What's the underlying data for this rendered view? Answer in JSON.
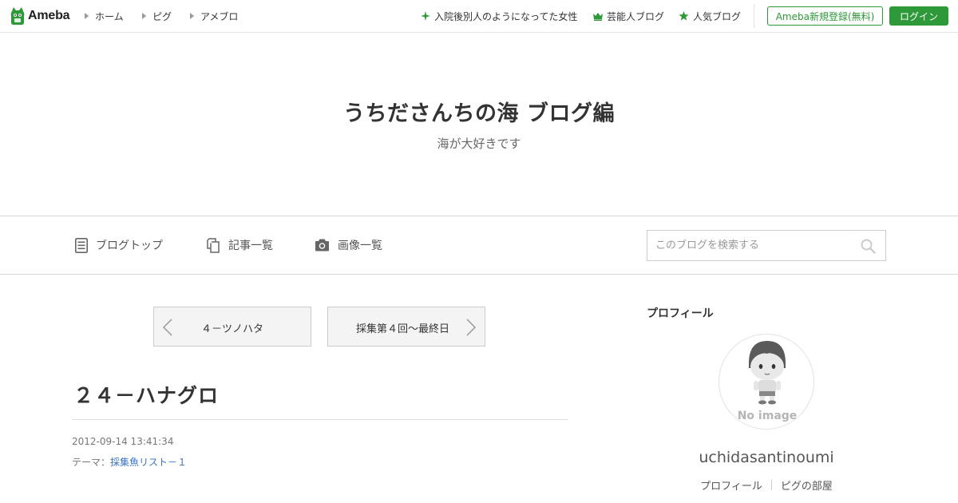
{
  "header": {
    "logo_text": "Ameba",
    "nav": [
      {
        "label": "ホーム"
      },
      {
        "label": "ピグ"
      },
      {
        "label": "アメブロ"
      }
    ],
    "right_links": [
      {
        "label": "入院後別人のようになってた女性",
        "icon": "sparkle-icon"
      },
      {
        "label": "芸能人ブログ",
        "icon": "crown-icon"
      },
      {
        "label": "人気ブログ",
        "icon": "star-icon"
      }
    ],
    "register_label": "Ameba新規登録(無料)",
    "login_label": "ログイン",
    "accent_color": "#2e9939"
  },
  "blog": {
    "title": "うちださんちの海 ブログ編",
    "subtitle": "海が大好きです"
  },
  "blog_nav": {
    "items": [
      {
        "label": "ブログトップ",
        "icon": "document-icon"
      },
      {
        "label": "記事一覧",
        "icon": "copy-icon"
      },
      {
        "label": "画像一覧",
        "icon": "camera-icon"
      }
    ],
    "search_placeholder": "このブログを検索する"
  },
  "pager": {
    "prev_label": "４－ツノハタ",
    "next_label": "採集第４回～最終日"
  },
  "entry": {
    "title": "２４－ハナグロ",
    "date": "2012-09-14 13:41:34",
    "theme_prefix": "テーマ：",
    "theme_label": "採集魚リスト－１",
    "link_color": "#3a75c4"
  },
  "sidebar": {
    "heading": "プロフィール",
    "avatar_text": "No image",
    "username": "uchidasantinoumi",
    "links": [
      {
        "label": "プロフィール"
      },
      {
        "label": "ピグの部屋"
      }
    ]
  }
}
